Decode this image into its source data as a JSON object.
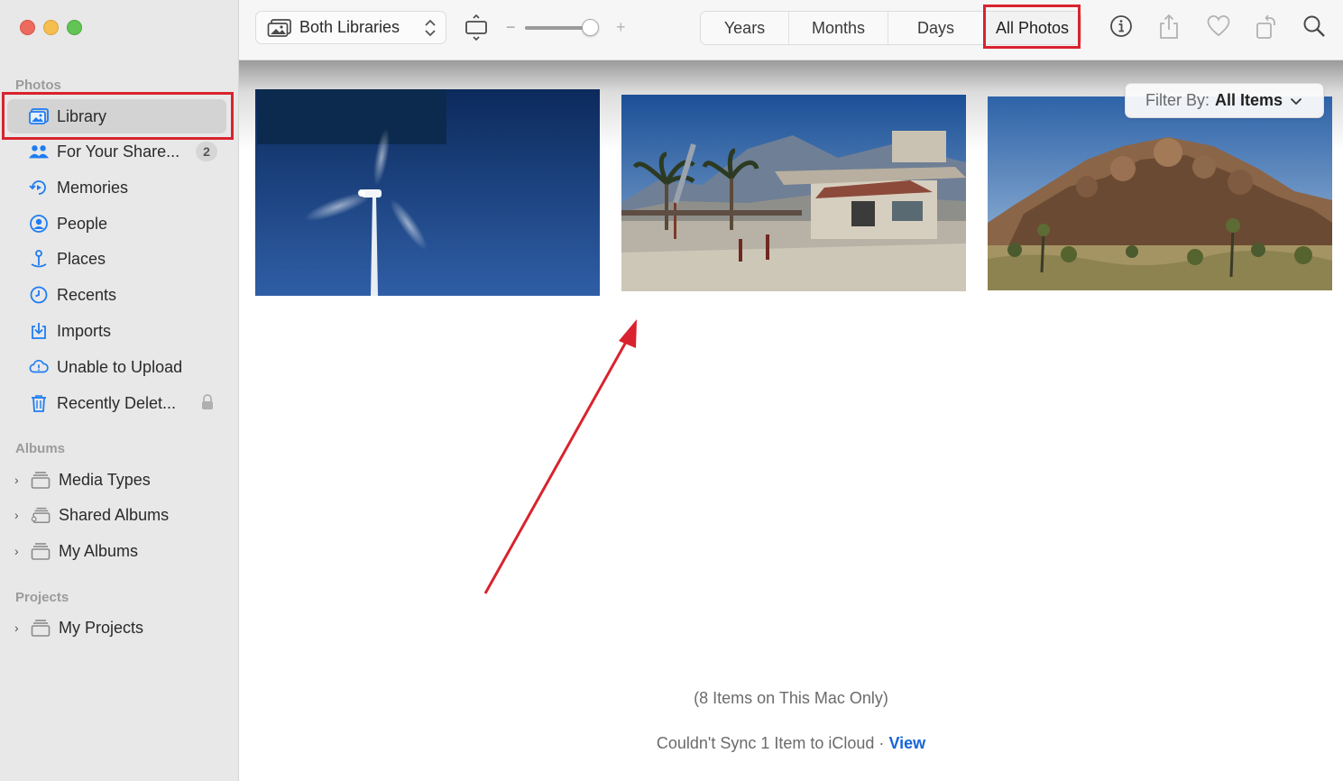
{
  "sidebar": {
    "sections": {
      "photos": "Photos",
      "albums": "Albums",
      "projects": "Projects"
    },
    "items": [
      {
        "label": "Library",
        "icon": "library-icon",
        "selected": true
      },
      {
        "label": "For Your Share...",
        "icon": "people-pair-icon",
        "badge": "2"
      },
      {
        "label": "Memories",
        "icon": "memories-icon"
      },
      {
        "label": "People",
        "icon": "person-circle-icon"
      },
      {
        "label": "Places",
        "icon": "pin-icon"
      },
      {
        "label": "Recents",
        "icon": "clock-icon"
      },
      {
        "label": "Imports",
        "icon": "import-icon"
      },
      {
        "label": "Unable to Upload",
        "icon": "cloud-warning-icon"
      },
      {
        "label": "Recently Delet...",
        "icon": "trash-icon",
        "locked": true
      }
    ],
    "albums": [
      {
        "label": "Media Types",
        "icon": "folder-stack-icon"
      },
      {
        "label": "Shared Albums",
        "icon": "shared-folder-icon"
      },
      {
        "label": "My Albums",
        "icon": "folder-stack-icon"
      }
    ],
    "projects": [
      {
        "label": "My Projects",
        "icon": "folder-stack-icon"
      }
    ]
  },
  "toolbar": {
    "library_select": "Both Libraries",
    "zoom_minus": "−",
    "zoom_plus": "+",
    "zoom_level": 0.9,
    "segments": [
      "Years",
      "Months",
      "Days",
      "All Photos"
    ],
    "active_segment": "All Photos"
  },
  "content": {
    "filter_label": "Filter By:",
    "filter_value": "All Items",
    "status_local": "(8 Items on This Mac Only)",
    "status_sync": "Couldn't Sync 1 Item to iCloud ·",
    "status_sync_link": "View"
  },
  "colors": {
    "highlight": "#d9232e",
    "link": "#1664d8",
    "sidebar_bg": "#e8e8e8"
  }
}
